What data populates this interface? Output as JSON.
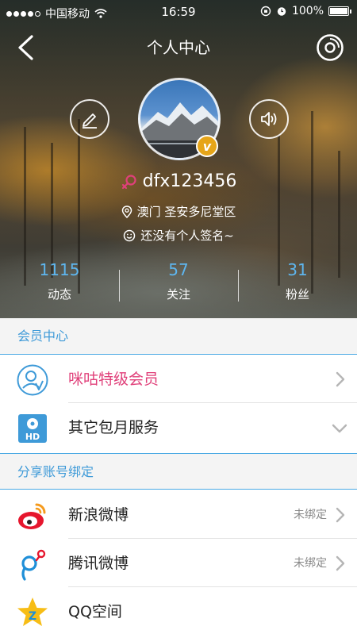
{
  "status_bar": {
    "carrier": "中国移动",
    "time": "16:59",
    "battery": "100%",
    "battery_level": 1.0
  },
  "nav": {
    "title": "个人中心",
    "back_icon": "chevron-left-icon",
    "right_icon": "music-disc-icon"
  },
  "profile": {
    "username": "dfx123456",
    "location": "澳门  圣安多尼堂区",
    "signature": "还没有个人签名~",
    "edit_icon": "pencil-icon",
    "sound_icon": "speaker-icon",
    "vip_badge": "v"
  },
  "stats": [
    {
      "value": "1115",
      "label": "动态"
    },
    {
      "value": "57",
      "label": "关注"
    },
    {
      "value": "31",
      "label": "粉丝"
    }
  ],
  "sections": {
    "member": {
      "title": "会员中心",
      "items": [
        {
          "label": "咪咕特级会员",
          "icon": "vip-member-icon",
          "arrow": "chevron-right-icon"
        },
        {
          "label": "其它包月服务",
          "icon": "hd-service-icon",
          "arrow": "chevron-down-icon"
        }
      ]
    },
    "share": {
      "title": "分享账号绑定",
      "items": [
        {
          "label": "新浪微博",
          "status": "未绑定",
          "icon": "sina-weibo-icon",
          "arrow": "chevron-right-icon"
        },
        {
          "label": "腾讯微博",
          "status": "未绑定",
          "icon": "tencent-weibo-icon",
          "arrow": "chevron-right-icon"
        },
        {
          "label": "QQ空间",
          "icon": "qzone-icon"
        }
      ]
    }
  },
  "colors": {
    "accent_blue": "#3e9ad8",
    "stat_blue": "#5eb6ef",
    "vip_pink": "#e0407a",
    "badge_gold": "#e6a519"
  }
}
